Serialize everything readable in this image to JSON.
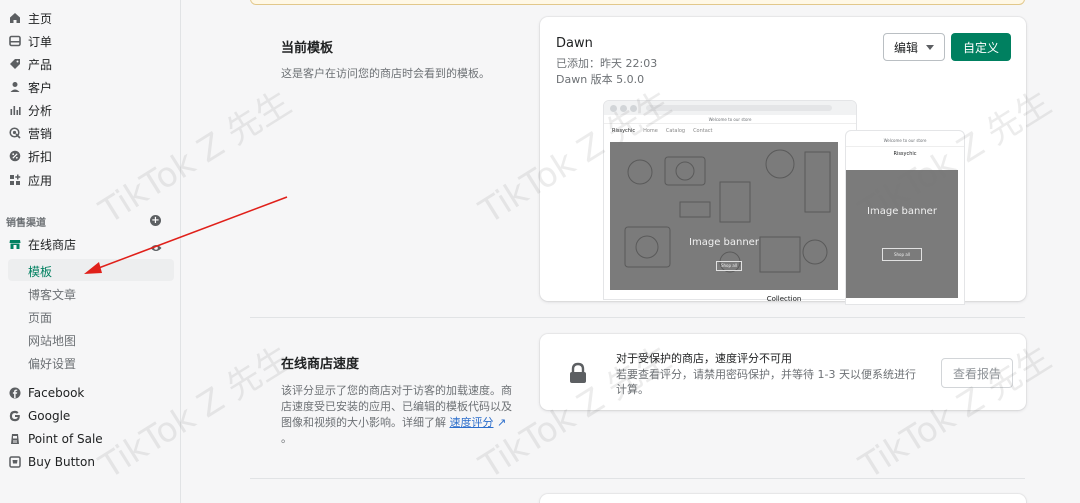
{
  "sidebar": {
    "nav": [
      {
        "label": "主页",
        "icon": "home-icon"
      },
      {
        "label": "订单",
        "icon": "orders-icon"
      },
      {
        "label": "产品",
        "icon": "tag-icon"
      },
      {
        "label": "客户",
        "icon": "person-icon"
      },
      {
        "label": "分析",
        "icon": "analytics-icon"
      },
      {
        "label": "营销",
        "icon": "marketing-icon"
      },
      {
        "label": "折扣",
        "icon": "discount-icon"
      },
      {
        "label": "应用",
        "icon": "apps-icon"
      }
    ],
    "sales_channels_header": "销售渠道",
    "online_store": "在线商店",
    "online_store_sub": [
      "模板",
      "博客文章",
      "页面",
      "网站地图",
      "偏好设置"
    ],
    "channels": [
      {
        "label": "Facebook",
        "icon": "facebook-icon"
      },
      {
        "label": "Google",
        "icon": "google-icon"
      },
      {
        "label": "Point of Sale",
        "icon": "pos-icon"
      },
      {
        "label": "Buy Button",
        "icon": "buy-button-icon"
      }
    ]
  },
  "current_theme": {
    "title": "当前模板",
    "description": "这是客户在访问您的商店时会看到的模板。",
    "name": "Dawn",
    "added": "已添加：昨天 22:03",
    "version": "Dawn 版本 5.0.0",
    "edit_label": "编辑",
    "customize_label": "自定义",
    "preview": {
      "announcement": "Welcome to our store",
      "store_name": "Rissychic",
      "nav_links": [
        "Home",
        "Catalog",
        "Contact"
      ],
      "banner_label": "Image banner",
      "banner_button": "Shop all",
      "bottom_text": "Collection"
    }
  },
  "store_speed": {
    "title": "在线商店速度",
    "description": "该评分显示了您的商店对于访客的加载速度。商店速度受已安装的应用、已编辑的模板代码以及图像和视频的大小影响。详细了解",
    "link": "速度评分",
    "suffix": "。",
    "card_title": "对于受保护的商店，速度评分不可用",
    "card_desc": "若要查看评分，请禁用密码保护，并等待 1-3 天以便系统进行计算。",
    "report_label": "查看报告"
  },
  "watermark": "TikTok Z 先生",
  "colors": {
    "accent": "#008060",
    "arrow": "#e0201a",
    "link": "#2c6ecb"
  }
}
